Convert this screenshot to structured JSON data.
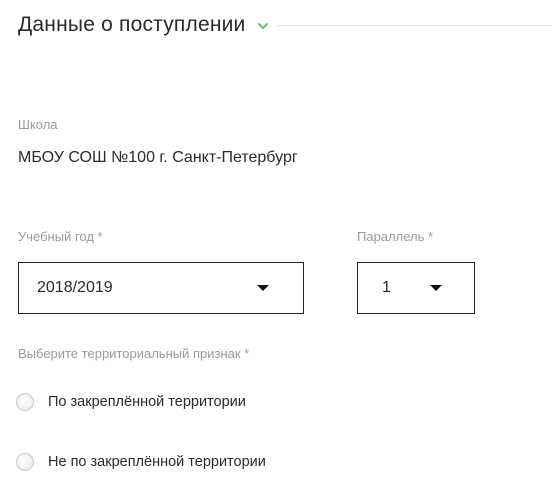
{
  "section": {
    "title": "Данные о поступлении"
  },
  "school": {
    "label": "Школа",
    "value": "МБОУ СОШ №100 г. Санкт-Петербург"
  },
  "academic_year": {
    "label": "Учебный год *",
    "value": "2018/2019"
  },
  "grade_parallel": {
    "label": "Параллель *",
    "value": "1"
  },
  "territory": {
    "label": "Выберите территориальный признак *",
    "options": [
      {
        "label": "По закреплённой территории"
      },
      {
        "label": "Не по закреплённой территории"
      }
    ]
  },
  "colors": {
    "accent": "#5cb85c",
    "label_gray": "#9a9a9a",
    "text": "#2b2b2b"
  },
  "icons": {
    "section_toggle": "chevron-down-icon",
    "select_caret": "caret-down-icon"
  }
}
